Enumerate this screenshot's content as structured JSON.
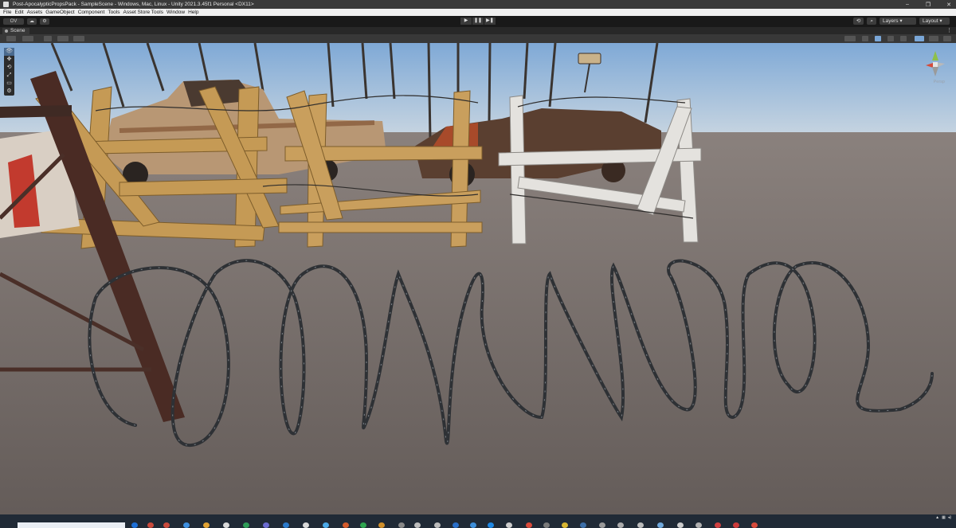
{
  "window": {
    "title": "Post-ApocalypticPropsPack - SampleScene - Windows, Mac, Linux - Unity 2021.3.45f1 Personal <DX11>",
    "controls": [
      "–",
      "❐",
      "✕"
    ]
  },
  "menu": {
    "items": [
      "File",
      "Edit",
      "Assets",
      "GameObject",
      "Component",
      "Tools",
      "Asset Store Tools",
      "Window",
      "Help"
    ]
  },
  "toolbar": {
    "account_label": "OV",
    "play_label": "▶",
    "pause_label": "❚❚",
    "step_label": "▶❚",
    "history_icon": "history-icon",
    "search_icon": "search-icon",
    "layers_label": "Layers",
    "layout_label": "Layout"
  },
  "tabs": {
    "scene_label": "Scene",
    "more_icon": "⋮"
  },
  "tools": [
    "👁",
    "✥",
    "⟲",
    "⤢",
    "▭",
    "⚙"
  ],
  "gizmo": {
    "label": "Persp"
  },
  "colors": {
    "sky_top": "#7fa9d6",
    "sky_bottom": "#c7d6e3",
    "ground": "#6f6764",
    "editor_bg": "#1e1e1e",
    "taskbar": "#202a36"
  }
}
